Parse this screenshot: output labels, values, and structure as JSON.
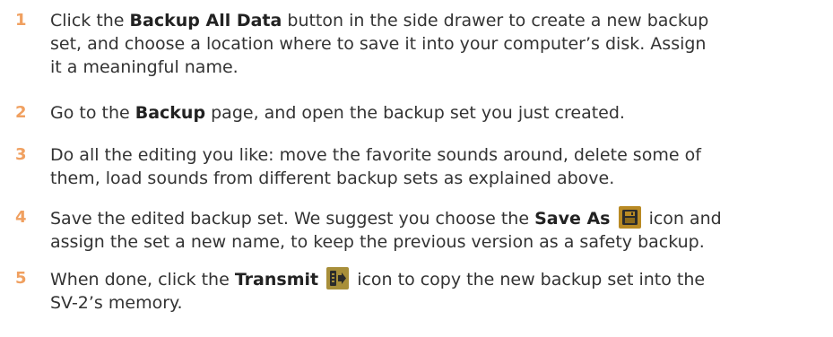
{
  "colors": {
    "step_number": "#f0a060",
    "text": "#333333",
    "save_icon_bg": "#b98a24",
    "save_icon_fg": "#2b2b2b",
    "transmit_icon_bg": "#a88f3a",
    "transmit_icon_fg": "#2b2b2b"
  },
  "steps": [
    {
      "number": "1",
      "lines": [
        {
          "a": "Click the ",
          "b": "Backup All Data",
          "c": " button in the side drawer to create a new backup"
        },
        {
          "a": "set, and choose a location where to save it into your computer’s disk. Assign"
        },
        {
          "a": "it a meaningful name."
        }
      ]
    },
    {
      "number": "2",
      "lines": [
        {
          "a": "Go to the ",
          "b": "Backup",
          "c": " page, and open the backup set you just created."
        }
      ]
    },
    {
      "number": "3",
      "lines": [
        {
          "a": "Do all the editing you like: move the favorite sounds around, delete some of"
        },
        {
          "a": "them, load sounds from different backup sets as explained above."
        }
      ]
    },
    {
      "number": "4",
      "lines": [
        {
          "a": "Save the edited backup set. We suggest you choose the ",
          "b": "Save As",
          "c": " icon and",
          "icon": "save-as-icon"
        },
        {
          "a": "assign the set a new name, to keep the previous version as a safety backup."
        }
      ]
    },
    {
      "number": "5",
      "lines": [
        {
          "a": "When done, click the ",
          "b": "Transmit",
          "c": " icon to copy the new backup set into the",
          "icon": "transmit-icon"
        },
        {
          "a": "SV-2’s memory."
        }
      ]
    }
  ]
}
